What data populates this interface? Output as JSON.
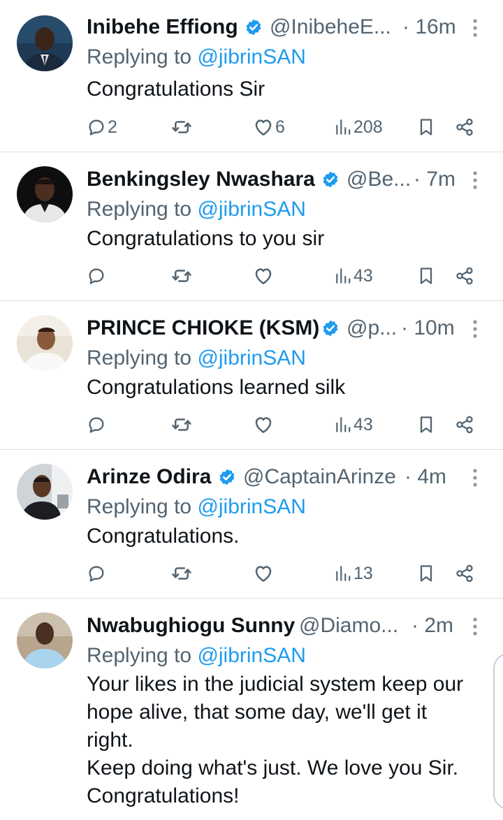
{
  "replying_prefix": "Replying to",
  "replies": [
    {
      "name": "Inibehe Effiong",
      "handle": "@InibeheE...",
      "time": "· 16m",
      "replying_to": "@jibrinSAN",
      "text": "Congratulations Sir",
      "replies": "2",
      "reposts": "",
      "likes": "6",
      "views": "208"
    },
    {
      "name": "Benkingsley Nwashara",
      "handle": "@Be...",
      "time": "· 7m",
      "replying_to": "@jibrinSAN",
      "text": "Congratulations to you sir",
      "replies": "",
      "reposts": "",
      "likes": "",
      "views": "43"
    },
    {
      "name": "PRINCE CHIOKE (KSM)",
      "handle": "@p...",
      "time": "· 10m",
      "replying_to": "@jibrinSAN",
      "text": "Congratulations learned silk",
      "replies": "",
      "reposts": "",
      "likes": "",
      "views": "43"
    },
    {
      "name": "Arinze Odira",
      "handle": "@CaptainArinze",
      "time": "· 4m",
      "replying_to": "@jibrinSAN",
      "text": "Congratulations.",
      "replies": "",
      "reposts": "",
      "likes": "",
      "views": "13"
    },
    {
      "name": "Nwabughiogu Sunny",
      "handle": "@Diamo...",
      "time": "· 2m",
      "replying_to": "@jibrinSAN",
      "text_lines": [
        "Your likes in the judicial system keep our",
        "hope alive, that some day, we'll get it",
        "right.",
        "Keep doing what's just. We love you Sir.",
        "Congratulations!"
      ]
    }
  ],
  "icons": {
    "verified": "verified-badge-icon",
    "more": "more-vertical-icon",
    "reply": "reply-bubble-icon",
    "repost": "repost-icon",
    "like": "heart-icon",
    "views": "views-bar-chart-icon",
    "bookmark": "bookmark-icon",
    "share": "share-icon"
  },
  "colors": {
    "text": "#0f1419",
    "secondary": "#536471",
    "link": "#1d9bf0",
    "divider": "#dadfe3"
  }
}
